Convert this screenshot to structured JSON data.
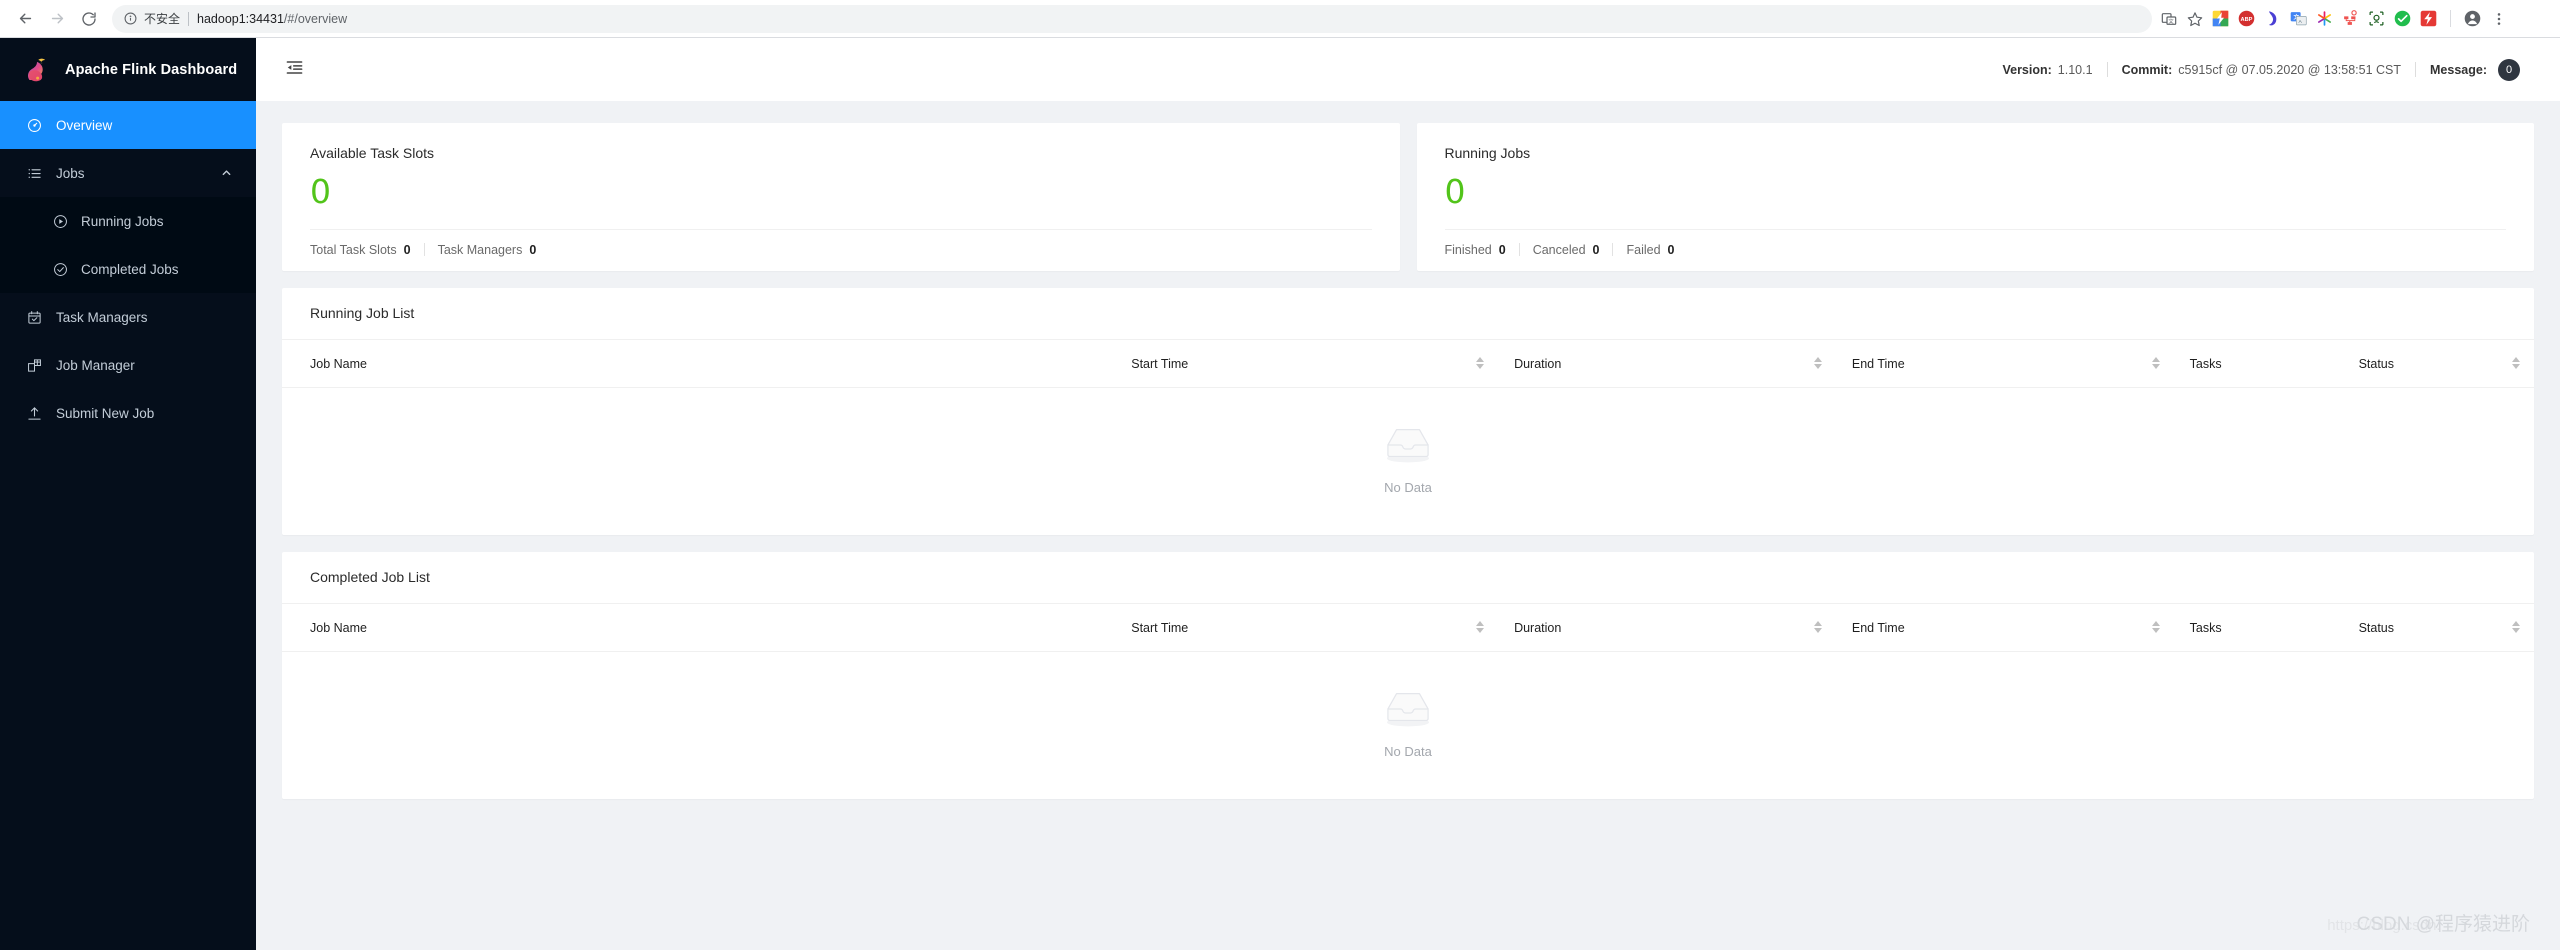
{
  "browser": {
    "back_icon": "back-arrow-icon",
    "forward_icon": "forward-arrow-icon",
    "reload_icon": "reload-icon",
    "security_label": "不安全",
    "url_host": "hadoop1:34431",
    "url_path": "/#/overview",
    "extensions": [
      {
        "name": "translate-icon",
        "label": "Translate"
      },
      {
        "name": "bookmark-star-icon",
        "label": "Bookmark"
      },
      {
        "name": "extension-lightning-colored-icon",
        "label": "Extension"
      },
      {
        "name": "adblock-plus-icon",
        "label": "ABP"
      },
      {
        "name": "grammar-check-icon",
        "label": "Grammar"
      },
      {
        "name": "google-translate-icon",
        "label": "Google Translate"
      },
      {
        "name": "asterisk-colorful-icon",
        "label": "Extension"
      },
      {
        "name": "sitemap-icon",
        "label": "Sitemap"
      },
      {
        "name": "screen-capture-icon",
        "label": "Capture"
      },
      {
        "name": "green-check-icon",
        "label": "Verified"
      },
      {
        "name": "red-flash-icon",
        "label": "Speed"
      }
    ],
    "profile_icon": "profile-avatar-icon",
    "menu_icon": "three-dot-menu-icon"
  },
  "sidebar": {
    "brand": "Apache Flink Dashboard",
    "logo_icon": "flink-squirrel-logo",
    "items": [
      {
        "label": "Overview",
        "icon": "dashboard-icon",
        "active": true
      },
      {
        "label": "Jobs",
        "icon": "list-icon",
        "expanded": true
      },
      {
        "label": "Running Jobs",
        "icon": "play-circle-icon",
        "sub": true
      },
      {
        "label": "Completed Jobs",
        "icon": "check-circle-icon",
        "sub": true
      },
      {
        "label": "Task Managers",
        "icon": "calendar-check-icon"
      },
      {
        "label": "Job Manager",
        "icon": "blocks-icon"
      },
      {
        "label": "Submit New Job",
        "icon": "upload-icon"
      }
    ]
  },
  "topbar": {
    "fold_icon": "menu-fold-icon",
    "version_label": "Version:",
    "version_value": "1.10.1",
    "commit_label": "Commit:",
    "commit_value": "c5915cf @ 07.05.2020 @ 13:58:51 CST",
    "message_label": "Message:",
    "message_count": "0"
  },
  "cards": {
    "task_slots": {
      "title": "Available Task Slots",
      "value": "0",
      "value_color": "#52c41a",
      "footer": [
        {
          "label": "Total Task Slots",
          "value": "0"
        },
        {
          "label": "Task Managers",
          "value": "0"
        }
      ]
    },
    "running_jobs": {
      "title": "Running Jobs",
      "value": "0",
      "value_color": "#52c41a",
      "footer": [
        {
          "label": "Finished",
          "value": "0"
        },
        {
          "label": "Canceled",
          "value": "0"
        },
        {
          "label": "Failed",
          "value": "0"
        }
      ]
    }
  },
  "running_job_list": {
    "title": "Running Job List",
    "columns": [
      {
        "label": "Job Name",
        "sortable": false
      },
      {
        "label": "Start Time",
        "sortable": true
      },
      {
        "label": "Duration",
        "sortable": true
      },
      {
        "label": "End Time",
        "sortable": true
      },
      {
        "label": "Tasks",
        "sortable": false
      },
      {
        "label": "Status",
        "sortable": true
      }
    ],
    "rows": [],
    "empty_text": "No Data",
    "empty_icon": "empty-box-icon"
  },
  "completed_job_list": {
    "title": "Completed Job List",
    "columns": [
      {
        "label": "Job Name",
        "sortable": false
      },
      {
        "label": "Start Time",
        "sortable": true
      },
      {
        "label": "Duration",
        "sortable": true
      },
      {
        "label": "End Time",
        "sortable": true
      },
      {
        "label": "Tasks",
        "sortable": false
      },
      {
        "label": "Status",
        "sortable": true
      }
    ],
    "rows": [],
    "empty_text": "No Data",
    "empty_icon": "empty-box-icon"
  },
  "watermark": {
    "url": "https://blog.csdn.",
    "brand": "CSDN @程序猿进阶"
  },
  "theme": {
    "sidebar_bg": "#050e1b",
    "submenu_bg": "#000a14",
    "accent": "#1890ff",
    "success": "#52c41a",
    "page_bg": "#f0f2f5"
  }
}
